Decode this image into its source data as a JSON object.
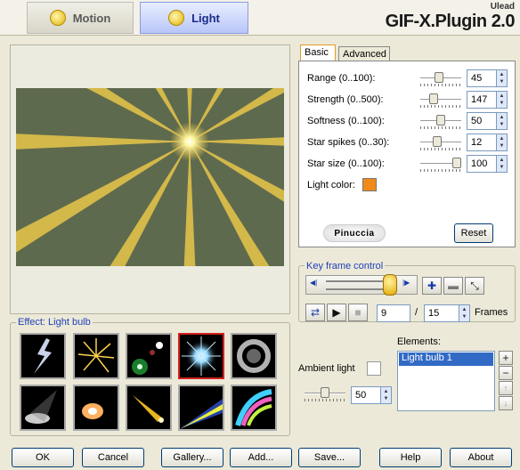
{
  "top_tabs": {
    "motion": "Motion",
    "light": "Light"
  },
  "brand": {
    "vendor": "Ulead",
    "product": "GIF-X.Plugin 2.0"
  },
  "tabs": {
    "basic": "Basic",
    "advanced": "Advanced"
  },
  "params": [
    {
      "label": "Range (0..100):",
      "value": "45",
      "level": 0.45
    },
    {
      "label": "Strength (0..500):",
      "value": "147",
      "level": 0.29
    },
    {
      "label": "Softness (0..100):",
      "value": "50",
      "level": 0.5
    },
    {
      "label": "Star spikes (0..30):",
      "value": "12",
      "level": 0.4
    },
    {
      "label": "Star size (0..100):",
      "value": "100",
      "level": 1.0
    }
  ],
  "light_color_label": "Light color:",
  "light_color": "#f08a1a",
  "signature": "Pinuccia",
  "reset_label": "Reset",
  "keyframe": {
    "label": "Key frame control",
    "current_frame": "9",
    "total_frames": "15",
    "frames_label": "Frames",
    "separator": "/"
  },
  "effect": {
    "label": "Effect: Light bulb"
  },
  "ambient": {
    "label": "Ambient light",
    "value": "50",
    "level": 0.5
  },
  "elements": {
    "label": "Elements:",
    "items": [
      "Light bulb 1"
    ]
  },
  "buttons": {
    "ok": "OK",
    "cancel": "Cancel",
    "gallery": "Gallery...",
    "add": "Add...",
    "save": "Save...",
    "help": "Help",
    "about": "About"
  }
}
